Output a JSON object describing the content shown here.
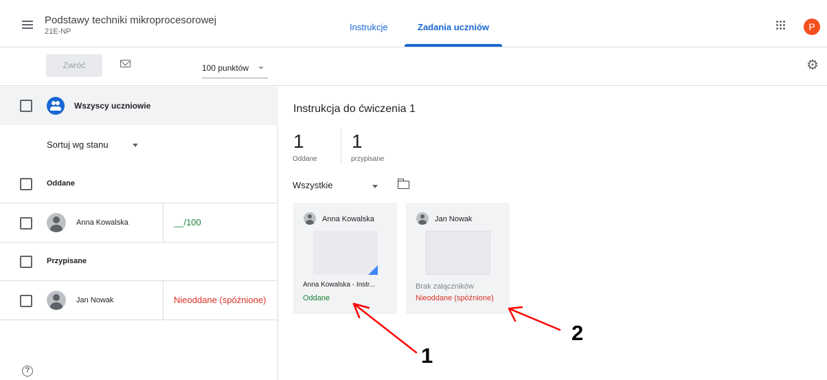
{
  "header": {
    "course_title": "Podstawy techniki mikroprocesorowej",
    "course_code": "21E-NP",
    "tabs": [
      {
        "label": "Instrukcje"
      },
      {
        "label": "Zadania uczniów"
      }
    ],
    "avatar_letter": "P",
    "colors": {
      "accent": "#1967d2",
      "avatar": "#f4511e"
    }
  },
  "toolbar": {
    "return_label": "Zwróć",
    "points": "100 punktów"
  },
  "left": {
    "all_students_label": "Wszyscy uczniowie",
    "sort_label": "Sortuj wg stanu",
    "sections": [
      {
        "label": "Oddane",
        "students": [
          {
            "name": "Anna Kowalska",
            "status": "__/100"
          }
        ]
      },
      {
        "label": "Przypisane",
        "students": [
          {
            "name": "Jan Nowak",
            "status": "Nieoddane (spóźnione)"
          }
        ]
      }
    ],
    "help_icon_glyph": "?"
  },
  "right": {
    "assignment_title": "Instrukcja do ćwiczenia 1",
    "stats": [
      {
        "value": "1",
        "label": "Oddane"
      },
      {
        "value": "1",
        "label": "przypisane"
      }
    ],
    "filter_label": "Wszystkie",
    "cards": [
      {
        "student": "Anna Kowalska",
        "file_name": "Anna Kowalska - Instr...",
        "status": "Oddane",
        "status_color": "#188038"
      },
      {
        "student": "Jan Nowak",
        "file_name": "Brak załączników",
        "status": "Nieoddane (spóźnione)",
        "status_color": "#d93025"
      }
    ]
  },
  "annotations": {
    "label_1": "1",
    "label_2": "2",
    "arrow_color": "#ff0000"
  }
}
